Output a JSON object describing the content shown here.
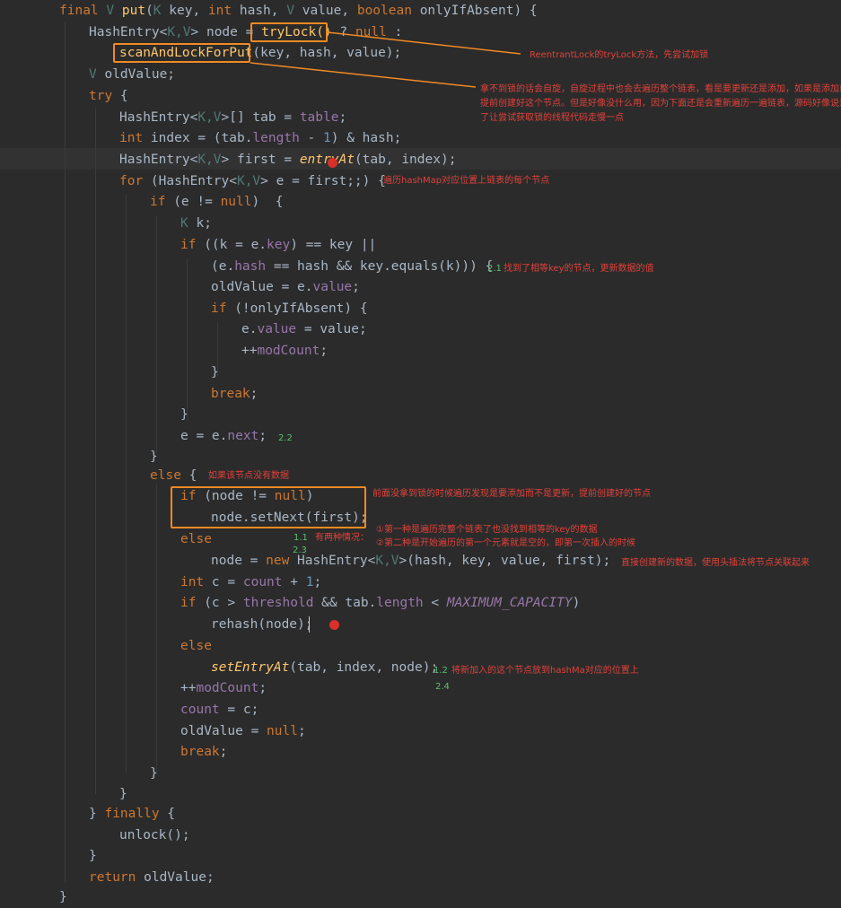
{
  "code": {
    "l1": [
      "final",
      "V",
      "put",
      "(",
      "K",
      "key,",
      "int",
      "hash,",
      "V",
      "value,",
      "boolean",
      "onlyIfAbsent) {"
    ],
    "l2": [
      "HashEntry<",
      "K,V",
      "> node = ",
      "tryLock()",
      " ? ",
      "null",
      " :"
    ],
    "l3": [
      "scanAndLockForPut",
      "(key, hash, value);"
    ],
    "l4": [
      "V",
      " oldValue;"
    ],
    "l5": [
      "try",
      " {"
    ],
    "l6": [
      "HashEntry<",
      "K,V",
      ">[] tab = ",
      "table",
      ";"
    ],
    "l7": [
      "int",
      " index = (tab.",
      "length",
      " - ",
      "1",
      ") & hash;"
    ],
    "l8": [
      "HashEntry<",
      "K,V",
      "> first = ",
      "entryAt",
      "(tab, index);"
    ],
    "l9": [
      "for",
      " (HashEntry<",
      "K,V",
      "> e = first;;) {"
    ],
    "l10": [
      "if",
      " (e != ",
      "null",
      ")  {"
    ],
    "l11": [
      "K",
      " k;"
    ],
    "l12": [
      "if",
      " ((k = e.",
      "key",
      ") == key ||"
    ],
    "l13": [
      "(e.",
      "hash",
      " == hash && key.equals(k))) {"
    ],
    "l14": [
      "oldValue = e.",
      "value",
      ";"
    ],
    "l15": [
      "if",
      " (!onlyIfAbsent) {"
    ],
    "l16": [
      "e.",
      "value",
      " = value;"
    ],
    "l17": [
      "++",
      "modCount",
      ";"
    ],
    "l18": [
      "}"
    ],
    "l19": [
      "break",
      ";"
    ],
    "l20": [
      "}"
    ],
    "l21": [
      "e = e.",
      "next",
      ";"
    ],
    "l22": [
      "}"
    ],
    "l23": [
      "else",
      " {"
    ],
    "l24": [
      "if",
      " (node != ",
      "null",
      ")"
    ],
    "l25": [
      "node.setNext(first);"
    ],
    "l26": [
      "else"
    ],
    "l27": [
      "node = ",
      "new",
      " HashEntry<",
      "K,V",
      ">(hash, key, value, first);"
    ],
    "l28": [
      "int",
      " c = ",
      "count",
      " + ",
      "1",
      ";"
    ],
    "l29": [
      "if",
      " (c > ",
      "threshold",
      " && tab.",
      "length",
      " < ",
      "MAXIMUM_CAPACITY",
      ")"
    ],
    "l30": [
      "rehash(node);"
    ],
    "l31": [
      "else"
    ],
    "l32": [
      "setEntryAt",
      "(tab, index, node);"
    ],
    "l33": [
      "++",
      "modCount",
      ";"
    ],
    "l34": [
      "count",
      " = c;"
    ],
    "l35": [
      "oldValue = ",
      "null",
      ";"
    ],
    "l36": [
      "break",
      ";"
    ],
    "l37": [
      "}"
    ],
    "l38": [
      "}"
    ],
    "l39": [
      "} ",
      "finally",
      " {"
    ],
    "l40": [
      "unlock();"
    ],
    "l41": [
      "}"
    ],
    "l42": [
      "return",
      " oldValue;"
    ],
    "l43": [
      "}"
    ]
  },
  "notes": {
    "trylock": "ReentrantLock的tryLock方法，先尝试加锁",
    "scan_1": "拿不到锁的话会自旋，自旋过程中也会去遍历整个链表，看是要更新还是添加，如果是添加就会",
    "scan_2": "提前创建好这个节点。但是好像没什么用，因为下面还是会重新遍历一遍链表，源码好像说是为",
    "scan_3": "了让尝试获取锁的线程代码走慢一点",
    "loop": "遍历hashMap对应位置上链表的每个节点",
    "found_num": "2.1",
    "found": "找到了相等key的节点，更新数据的值",
    "next_num": "2.2",
    "else": "如果该节点没有数据",
    "prebuilt": "前面没拿到锁的时候遍历发现是要添加而不是更新，提前创建好的节点",
    "n11": "1.1",
    "n23": "2.3",
    "two_cases": "有两种情况：",
    "case1": "①第一种是遍历完整个链表了也没找到相等的key的数据",
    "case2": "②第二种是开始遍历的第一个元素就是空的，即第一次插入的时候",
    "direct": "直接创建新的数据，使用头插法将节点关联起来",
    "n12": "1.2",
    "set_entry": "将新加入的这个节点放到hashMa对应的位置上",
    "n24": "2.4"
  },
  "colors": {
    "background": "#2b2b2b",
    "keyword": "#cc7832",
    "text": "#a9b7c6",
    "field": "#9876aa",
    "method": "#ffc66d",
    "generic": "#507874",
    "number": "#6897bb",
    "highlight_box": "#f08a24",
    "note_red": "#e0413a",
    "note_green": "#56c26a"
  }
}
